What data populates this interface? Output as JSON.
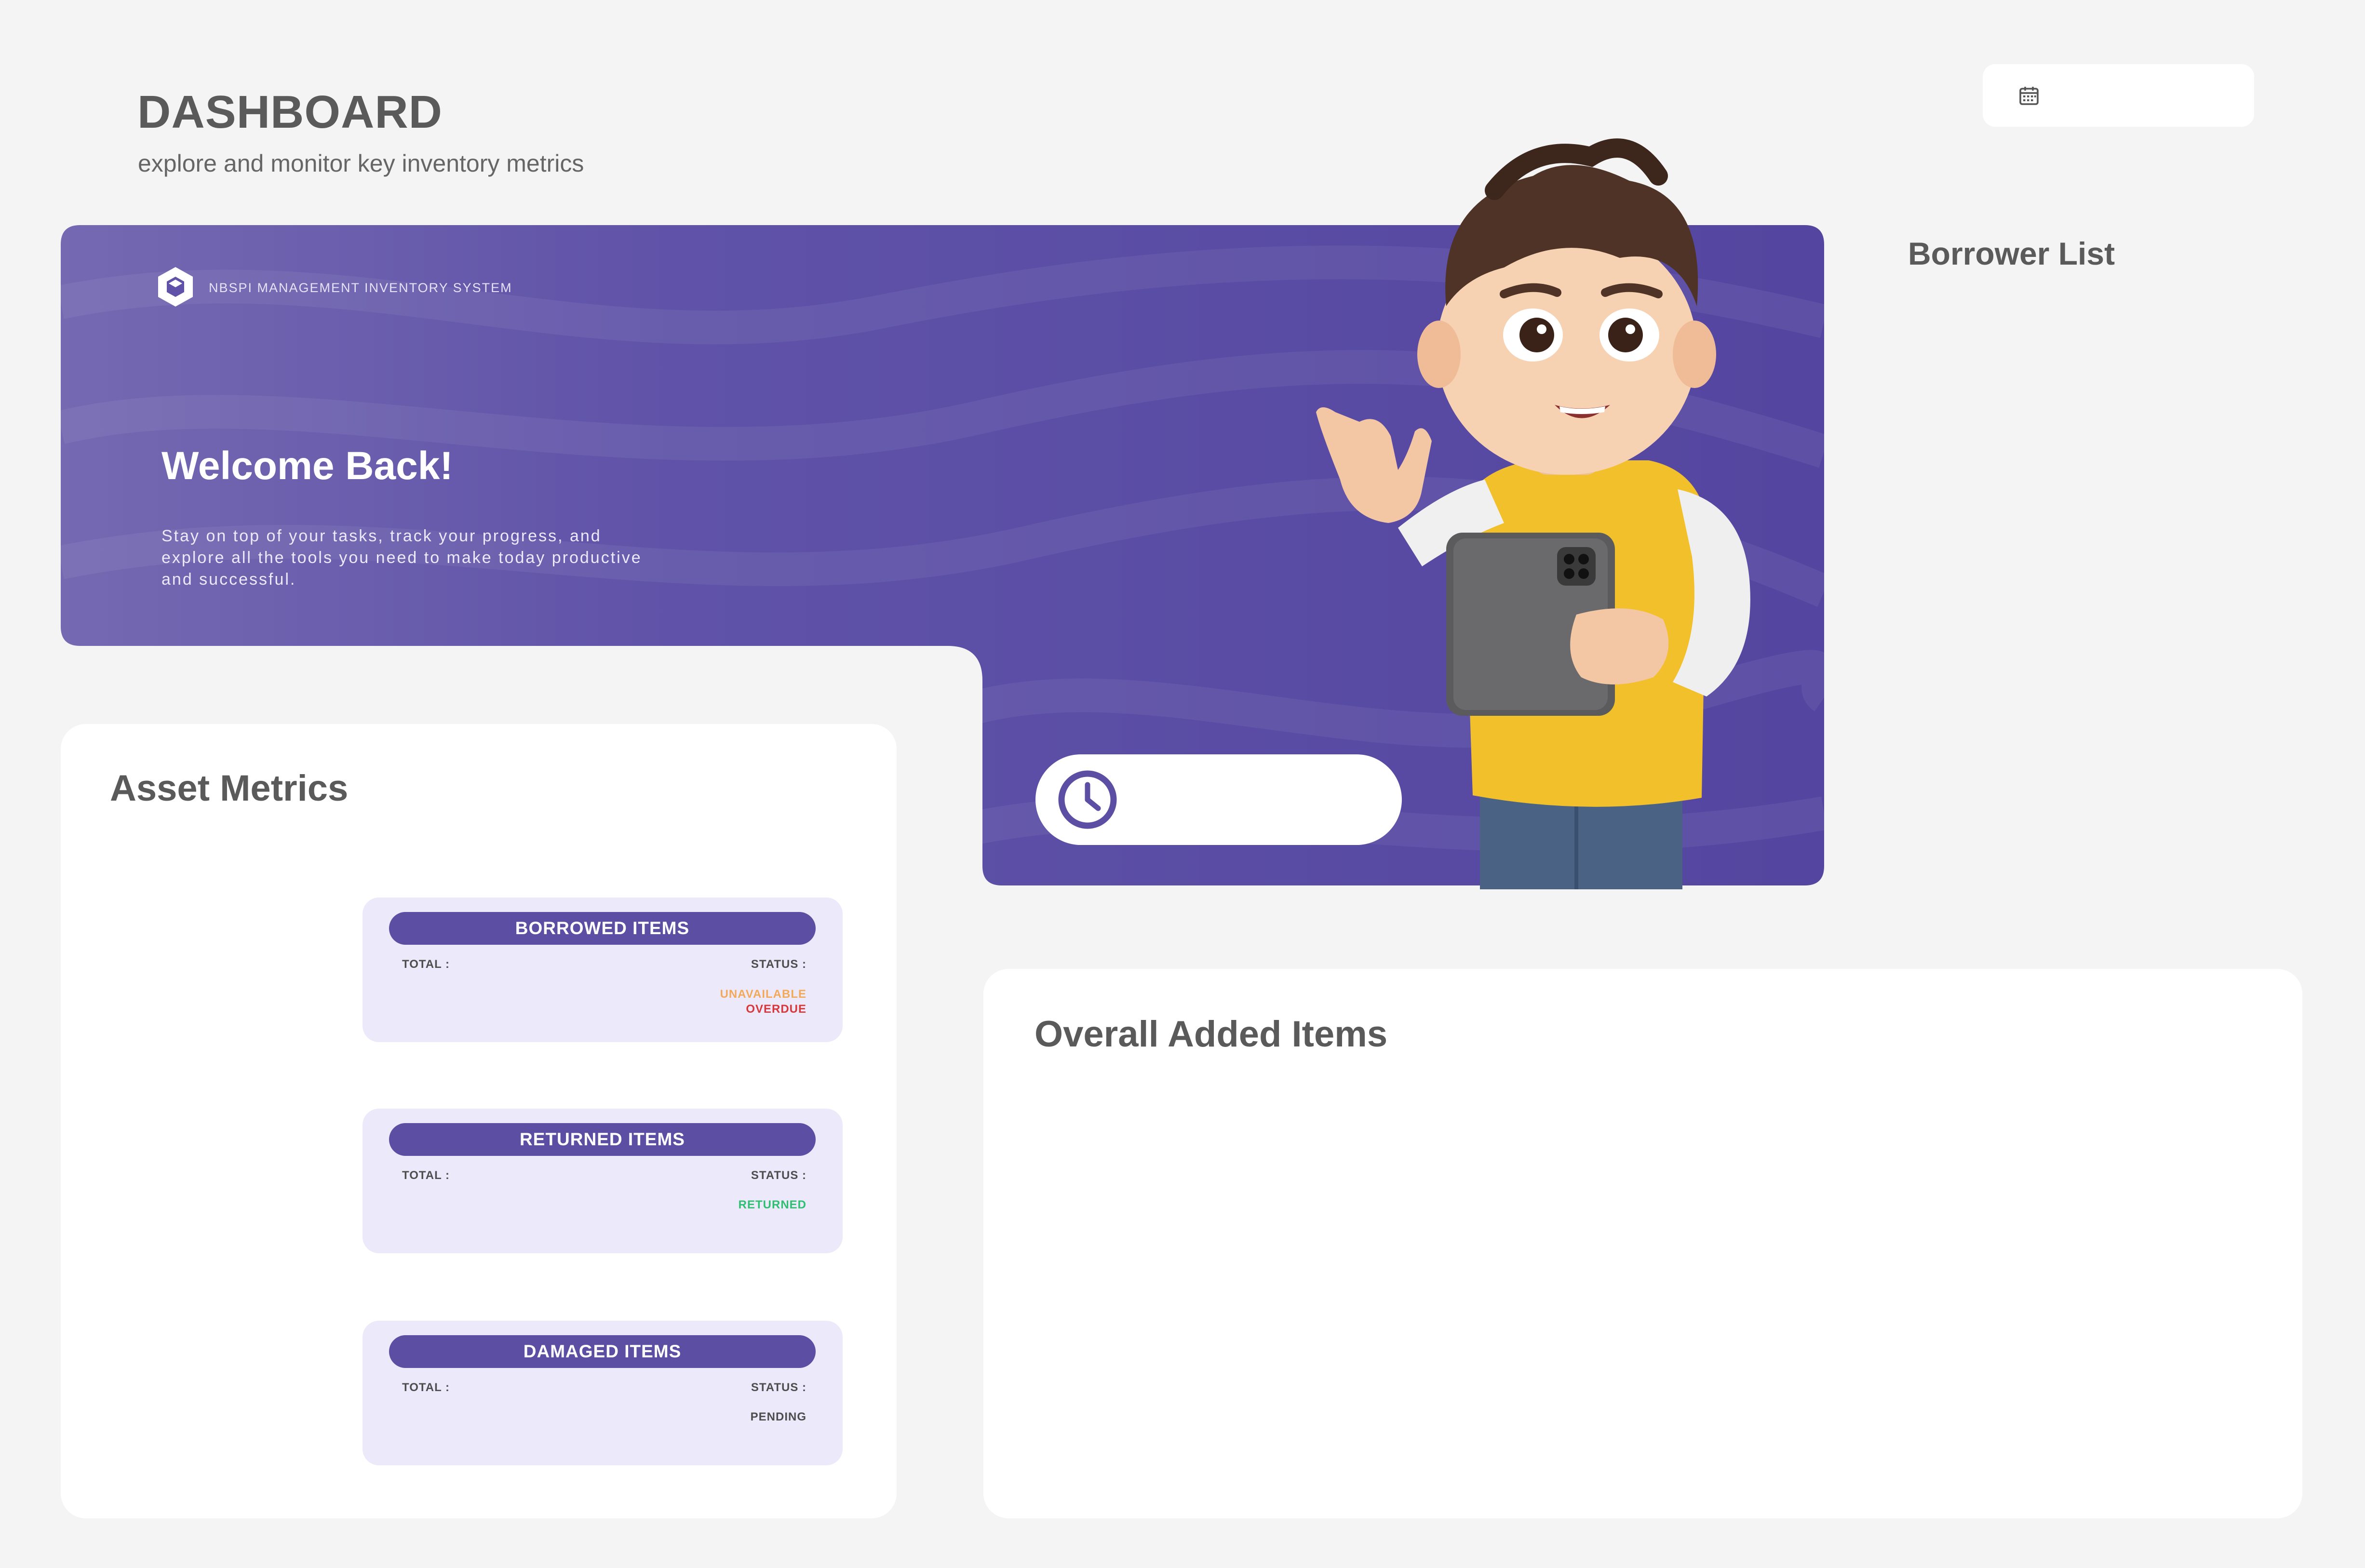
{
  "header": {
    "title": "DASHBOARD",
    "subtitle": "explore and monitor key inventory metrics"
  },
  "date_picker": {
    "icon": "calendar-icon",
    "value": ""
  },
  "hero": {
    "brand_name": "NBSPI MANAGEMENT INVENTORY SYSTEM",
    "brand_icon": "cube-logo-icon",
    "welcome": "Welcome Back!",
    "description": "Stay on top of your tasks, track your progress, and explore all the tools you need to make today productive and successful.",
    "clock_icon": "clock-icon",
    "time_value": "",
    "accent": "#5b4ea3"
  },
  "borrower_list": {
    "title": "Borrower List"
  },
  "asset_metrics": {
    "title": "Asset Metrics",
    "cards": [
      {
        "title": "BORROWED ITEMS",
        "total_label": "TOTAL :",
        "status_label": "STATUS :",
        "statuses": [
          {
            "text": "UNAVAILABLE",
            "color": "#f3a95a"
          },
          {
            "text": "OVERDUE",
            "color": "#d9383a"
          }
        ]
      },
      {
        "title": "RETURNED ITEMS",
        "total_label": "TOTAL :",
        "status_label": "STATUS :",
        "statuses": [
          {
            "text": "RETURNED",
            "color": "#2fbf71"
          }
        ]
      },
      {
        "title": "DAMAGED ITEMS",
        "total_label": "TOTAL :",
        "status_label": "STATUS :",
        "statuses": [
          {
            "text": "PENDING",
            "color": "#4d4d4d"
          }
        ]
      }
    ]
  },
  "overall_added_items": {
    "title": "Overall Added Items"
  }
}
